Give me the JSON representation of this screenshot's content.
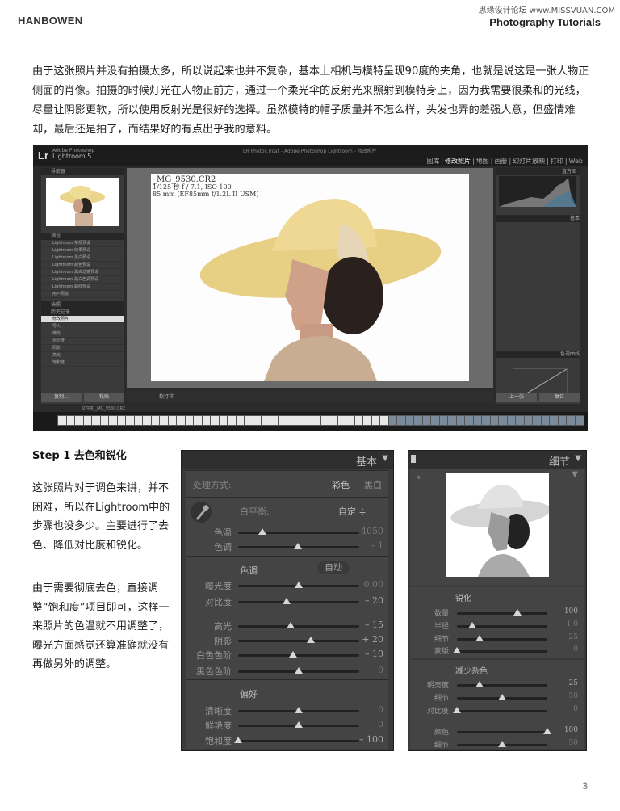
{
  "header": {
    "brand": "HANBOWEN",
    "series": "Photography Tutorials",
    "watermark": "思缘设计论坛 www.MISSVUAN.COM"
  },
  "intro": "由于这张照片并没有拍摄太多，所以说起来也并不复杂，基本上相机与模特呈现90度的夹角，也就是说这是一张人物正侧面的肖像。拍摄的时候灯光在人物正前方，通过一个柔光伞的反射光来照射到模特身上，因为我需要很柔和的光线，尽量让阴影更软，所以使用反射光是很好的选择。虽然模特的帽子质量并不怎么样，头发也弄的差强人意，但盛情难却，最后还是拍了，而结果好的有点出乎我的意料。",
  "lightroom": {
    "logo": "Lr",
    "product_small": "Adobe Photoshop",
    "product": "Lightroom 5",
    "window_title": "LR Photos.lrcat - Adobe Photoshop Lightroom - 修改照片",
    "modules": [
      "图库",
      "修改照片",
      "地图",
      "画册",
      "幻灯片放映",
      "打印",
      "Web"
    ],
    "selected_module": "修改照片",
    "left_panels": [
      "导航器",
      "预设",
      "快照",
      "历史记录"
    ],
    "presets": [
      "Lightroom 常规预设",
      "Lightroom 效果预设",
      "Lightroom 黑白预设",
      "Lightroom 颜色预设",
      "Lightroom 黑白滤镜预设",
      "Lightroom 黑白色调预设",
      "Lightroom 曲线预设",
      "用户预设"
    ],
    "history": [
      "修改照片",
      "导入",
      "曝光",
      "对比度",
      "阴影",
      "高光",
      "饱和度"
    ],
    "left_buttons": [
      "复制...",
      "粘贴"
    ],
    "right_panels": [
      "直方图",
      "基本",
      "色调曲线"
    ],
    "right_buttons": [
      "上一张",
      "复位"
    ],
    "overlay": {
      "filename": "_MG_9530.CR2",
      "exposure": "1/125 秒 f / 7.1, ISO 100",
      "lens": "85 mm (EF85mm f/1.2L II USM)"
    },
    "toolbar_label": "软打样",
    "filmstrip_label": "文件夹 _MG_9530.CR2"
  },
  "step": {
    "heading": "Step 1 去色和锐化",
    "para1": "这张照片对于调色来讲，并不困难，所以在Lightroom中的步骤也没多少。主要进行了去色、降低对比度和锐化。",
    "para2": "由于需要彻底去色，直接调整“饱和度”项目即可，这样一来照片的色温就不用调整了，曝光方面感觉还算准确就没有再做另外的调整。"
  },
  "basic": {
    "title": "基本",
    "treatment_label": "处理方式:",
    "treatment_color": "彩色",
    "treatment_bw": "黑白",
    "wb_label": "白平衡:",
    "wb_value": "自定 ≑",
    "tone_label": "色调",
    "auto_label": "自动",
    "presence_label": "偏好",
    "sliders": [
      {
        "label": "色温",
        "value": "4050",
        "pos": 0.2,
        "dim": true
      },
      {
        "label": "色调",
        "value": "– 1",
        "pos": 0.49,
        "dim": true
      },
      {
        "label": "曝光度",
        "value": "0.00",
        "pos": 0.5,
        "dim": true
      },
      {
        "label": "对比度",
        "value": "– 20",
        "pos": 0.4,
        "dim": false
      },
      {
        "label": "高光",
        "value": "– 15",
        "pos": 0.43,
        "dim": false
      },
      {
        "label": "阴影",
        "value": "+ 20",
        "pos": 0.6,
        "dim": false
      },
      {
        "label": "白色色阶",
        "value": "– 10",
        "pos": 0.45,
        "dim": false
      },
      {
        "label": "黑色色阶",
        "value": "0",
        "pos": 0.5,
        "dim": true
      },
      {
        "label": "清晰度",
        "value": "0",
        "pos": 0.5,
        "dim": true
      },
      {
        "label": "鲜艳度",
        "value": "0",
        "pos": 0.5,
        "dim": true
      },
      {
        "label": "饱和度",
        "value": "– 100",
        "pos": 0.0,
        "dim": false
      }
    ]
  },
  "detail": {
    "title": "细节",
    "sharpen_label": "锐化",
    "noise_label": "减少杂色",
    "sliders": [
      {
        "label": "数量",
        "value": "100",
        "pos": 0.67,
        "dim": false
      },
      {
        "label": "半径",
        "value": "1.0",
        "pos": 0.17,
        "dim": true
      },
      {
        "label": "细节",
        "value": "25",
        "pos": 0.25,
        "dim": true
      },
      {
        "label": "蒙版",
        "value": "0",
        "pos": 0.0,
        "dim": true
      },
      {
        "label": "明亮度",
        "value": "25",
        "pos": 0.25,
        "dim": false
      },
      {
        "label": "细节",
        "value": "50",
        "pos": 0.5,
        "dim": true
      },
      {
        "label": "对比度",
        "value": "0",
        "pos": 0.0,
        "dim": true
      },
      {
        "label": "颜色",
        "value": "100",
        "pos": 1.0,
        "dim": false
      },
      {
        "label": "细节",
        "value": "50",
        "pos": 0.5,
        "dim": true
      }
    ]
  },
  "page_number": "3"
}
